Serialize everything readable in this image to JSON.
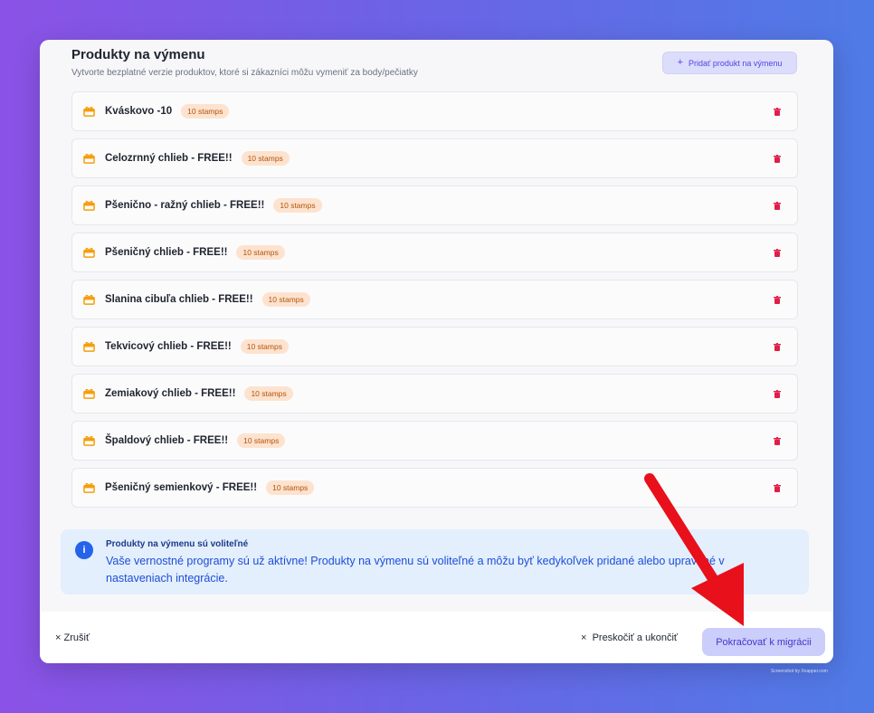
{
  "section": {
    "title": "Produkty na výmenu",
    "subtitle": "Vytvorte bezplatné verzie produktov, ktoré si zákazníci môžu vymeniť za body/pečiatky",
    "add_button": "Pridať produkt na výmenu"
  },
  "products": [
    {
      "name": "Kváskovo -10",
      "badge": "10 stamps"
    },
    {
      "name": "Celozrnný chlieb - FREE!!",
      "badge": "10 stamps"
    },
    {
      "name": "Pšenično - ražný chlieb - FREE!!",
      "badge": "10 stamps"
    },
    {
      "name": "Pšeničný chlieb - FREE!!",
      "badge": "10 stamps"
    },
    {
      "name": "Slanina cibuľa chlieb - FREE!!",
      "badge": "10 stamps"
    },
    {
      "name": "Tekvicový chlieb - FREE!!",
      "badge": "10 stamps"
    },
    {
      "name": "Zemiakový chlieb - FREE!!",
      "badge": "10 stamps"
    },
    {
      "name": "Špaldový chlieb - FREE!!",
      "badge": "10 stamps"
    },
    {
      "name": "Pšeničný semienkový - FREE!!",
      "badge": "10 stamps"
    }
  ],
  "info": {
    "title": "Produkty na výmenu sú voliteľné",
    "text": "Vaše vernostné programy sú už aktívne! Produkty na výmenu sú voliteľné a môžu byť kedykoľvek pridané alebo upravené v nastaveniach integrácie."
  },
  "footer": {
    "cancel": "Zrušiť",
    "skip": "Preskočiť a ukončiť",
    "continue": "Pokračovať k migrácii"
  },
  "watermark": "Screenshot by Xnapper.com",
  "colors": {
    "accent": "#4f46e5",
    "badge_bg": "#fde3cf",
    "trash": "#e11d48",
    "arrow": "#e8101a"
  }
}
